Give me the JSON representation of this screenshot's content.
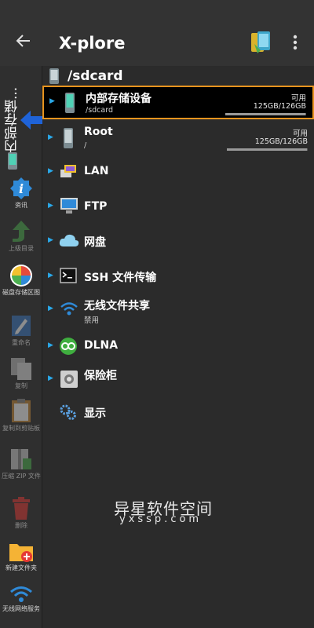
{
  "app": {
    "title": "X-plore"
  },
  "sidebar": {
    "vertical_label": "内部存储...",
    "tools": [
      {
        "label": "资讯",
        "icon": "info-icon"
      },
      {
        "label": "上级目录",
        "icon": "up-arrow-icon"
      },
      {
        "label": "磁盘存储区图",
        "icon": "disk-map-icon"
      },
      {
        "label": "重命名",
        "icon": "rename-icon"
      },
      {
        "label": "复制",
        "icon": "copy-icon"
      },
      {
        "label": "复制到剪贴板",
        "icon": "clipboard-icon"
      },
      {
        "label": "压缩 ZIP 文件",
        "icon": "zip-icon"
      },
      {
        "label": "删除",
        "icon": "trash-icon"
      },
      {
        "label": "新建文件夹",
        "icon": "new-folder-icon"
      },
      {
        "label": "无线网络服务",
        "icon": "wifi-icon"
      }
    ]
  },
  "path": "/sdcard",
  "items": [
    {
      "label": "内部存储设备",
      "sub": "/sdcard",
      "avail_label": "可用",
      "size": "125GB/126GB",
      "fill": 0.99
    },
    {
      "label": "Root",
      "sub": "/",
      "avail_label": "可用",
      "size": "125GB/126GB",
      "fill": 0.99
    },
    {
      "label": "LAN"
    },
    {
      "label": "FTP"
    },
    {
      "label": "网盘"
    },
    {
      "label": "SSH 文件传输"
    },
    {
      "label": "无线文件共享",
      "sub": "禁用"
    },
    {
      "label": "DLNA"
    },
    {
      "label": "保险柜"
    },
    {
      "label": "显示"
    }
  ],
  "watermark": {
    "line1": "异星软件空间",
    "line2": "yxssp.com"
  }
}
